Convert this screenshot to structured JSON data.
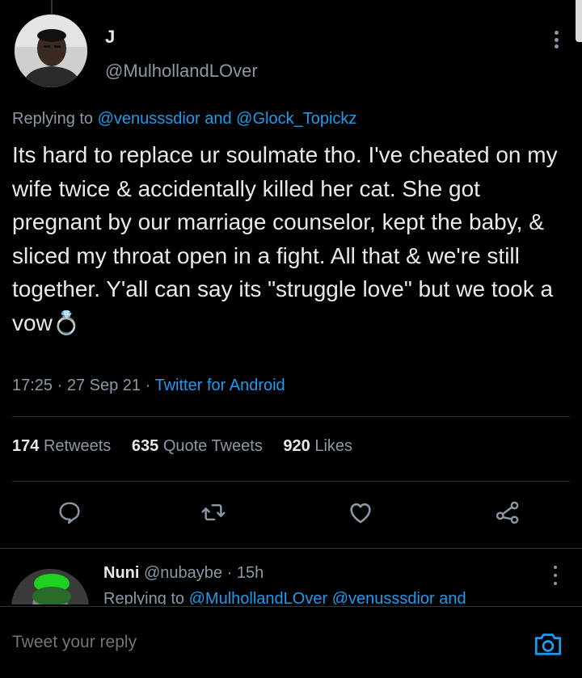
{
  "colors": {
    "background": "#000000",
    "text": "#e7e9ea",
    "secondary": "#8b98a5",
    "accent": "#1d9bf0",
    "divider": "#2f3336"
  },
  "tweet": {
    "author_name": "J",
    "author_handle": "@MulhollandLOver",
    "replying_prefix": "Replying to",
    "replying_mention_1": "@venusssdior",
    "replying_and": "and",
    "replying_mention_2": "@Glock_Topickz",
    "text": "Its hard to replace ur soulmate tho. I've cheated on my wife twice & accidentally killed her cat. She got pregnant by our marriage counselor, kept the baby, & sliced my throat open in a fight. All that & we're still together. Y'all can say its \"struggle love\" but we took a vow💍",
    "time": "17:25",
    "date": "27 Sep 21",
    "separator": "·",
    "source": "Twitter for Android"
  },
  "stats": {
    "retweets_count": "174",
    "retweets_label": "Retweets",
    "quotes_count": "635",
    "quotes_label": "Quote Tweets",
    "likes_count": "920",
    "likes_label": "Likes"
  },
  "actions": {
    "reply_icon": "reply-bubble-icon",
    "retweet_icon": "retweet-icon",
    "like_icon": "heart-icon",
    "share_icon": "share-icon"
  },
  "reply": {
    "name": "Nuni",
    "handle": "@nubaybe",
    "separator": "·",
    "age": "15h",
    "replying_prefix": "Replying to",
    "mention_1": "@MulhollandLOver",
    "mention_2": "@venusssdior",
    "and": "and"
  },
  "compose": {
    "placeholder": "Tweet your reply",
    "camera_icon": "camera-icon"
  }
}
